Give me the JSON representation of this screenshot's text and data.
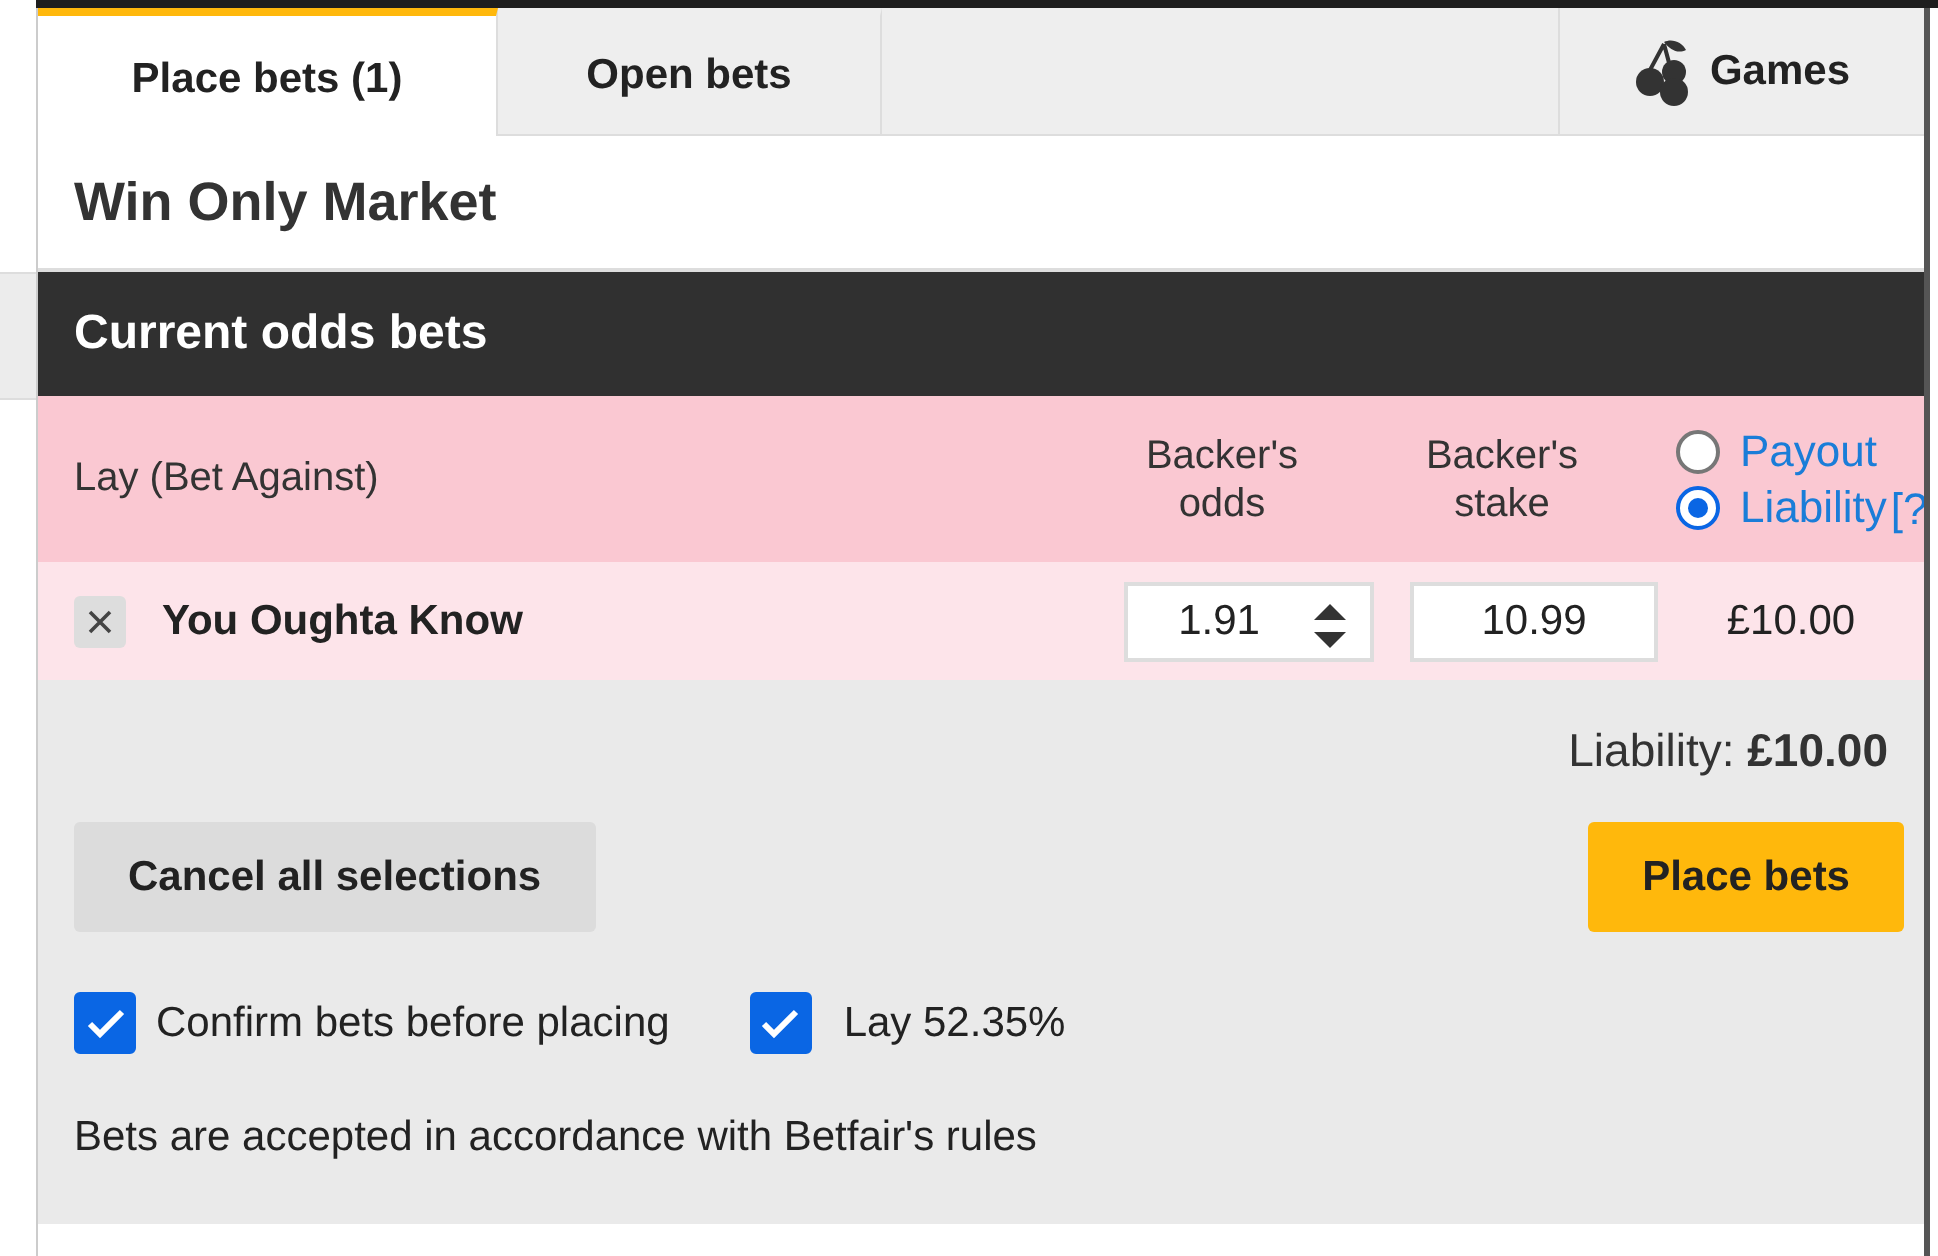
{
  "tabs": [
    {
      "label": "Place bets (1)",
      "selected": true
    },
    {
      "label": "Open bets",
      "selected": false
    }
  ],
  "games_tab": {
    "label": "Games"
  },
  "market_title": "Win Only Market",
  "section_title": "Current odds bets",
  "header": {
    "bet_type": "Lay (Bet Against)",
    "odds_label": "Backer's odds",
    "stake_label": "Backer's stake",
    "options": [
      {
        "label": "Payout",
        "selected": false
      },
      {
        "label": "Liability",
        "selected": true
      }
    ],
    "help": "[?"
  },
  "bets": [
    {
      "selection": "You Oughta Know",
      "odds": "1.91",
      "stake": "10.99",
      "amount": "£10.00"
    }
  ],
  "liability": {
    "label": "Liability:",
    "value": "£10.00"
  },
  "buttons": {
    "cancel": "Cancel all selections",
    "place": "Place bets"
  },
  "checkboxes": [
    {
      "label": "Confirm bets before placing",
      "checked": true
    },
    {
      "label": "Lay 52.35%",
      "checked": true
    }
  ],
  "rules_note": "Bets are accepted in accordance with Betfair's rules"
}
